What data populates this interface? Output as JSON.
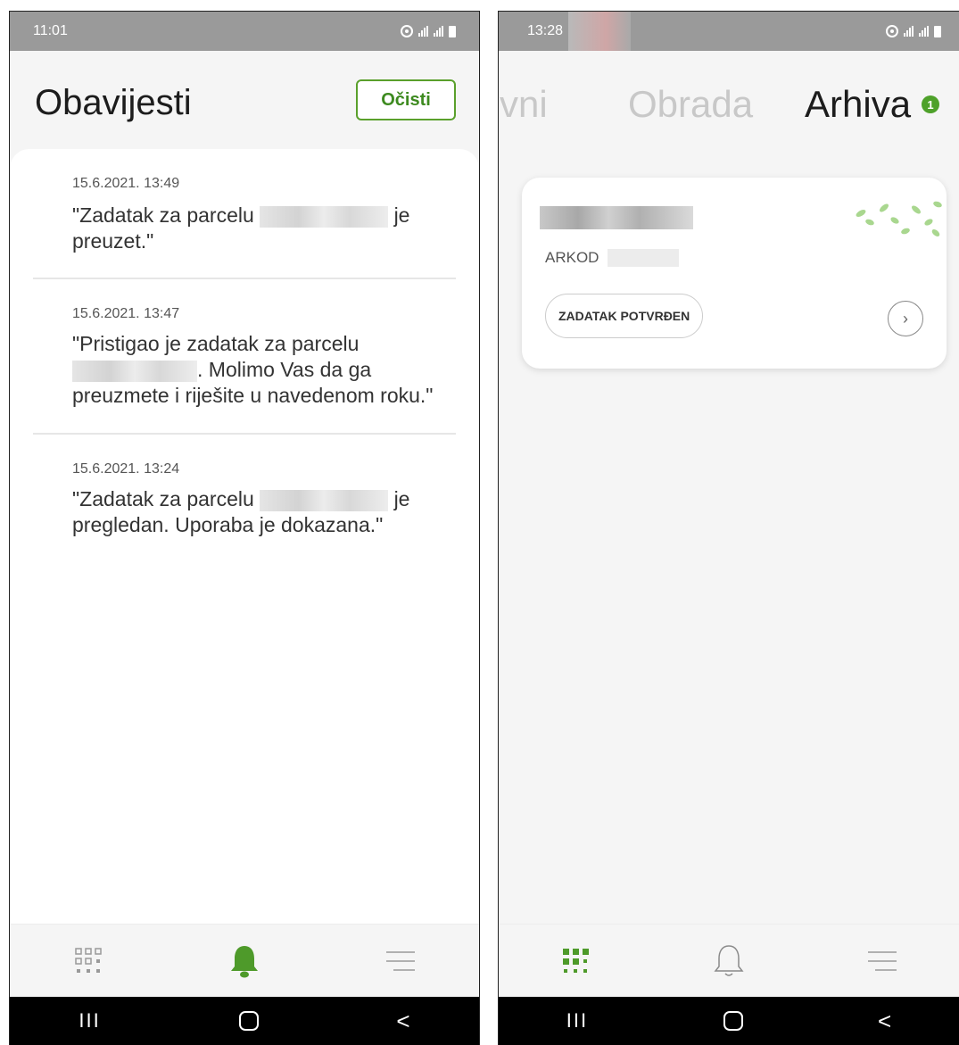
{
  "left": {
    "status_time": "11:01",
    "title": "Obavijesti",
    "clear_label": "Očisti",
    "notifications": [
      {
        "time": "15.6.2021. 13:49",
        "text_a": "\"Zadatak za parcelu",
        "text_b": "je",
        "text_c": "preuzet.\""
      },
      {
        "time": "15.6.2021. 13:47",
        "text_a": "\"Pristigao je zadatak za parcelu",
        "text_b": ". Molimo Vas da ga",
        "text_c": "preuzmete i riješite u navedenom roku.\""
      },
      {
        "time": "15.6.2021. 13:24",
        "text_a": "\"Zadatak za parcelu",
        "text_b": "je",
        "text_c": "pregledan. Uporaba je dokazana.\""
      }
    ],
    "nav": {
      "items": [
        "grid-icon",
        "bell-icon",
        "menu-icon"
      ],
      "active": "bell-icon",
      "accent": "#5aa02c"
    }
  },
  "right": {
    "status_time": "13:28",
    "tabs": [
      "tivni",
      "Obrada",
      "Arhiva"
    ],
    "archive_badge": "1",
    "card": {
      "arkod_label": "ARKOD",
      "status": "ZADATAK POTVRĐEN"
    },
    "nav": {
      "items": [
        "grid-icon",
        "bell-icon",
        "menu-icon"
      ],
      "active": "grid-icon",
      "accent": "#5aa02c"
    }
  },
  "sysbar": {
    "recent": "III",
    "home": "O",
    "back": "<"
  }
}
